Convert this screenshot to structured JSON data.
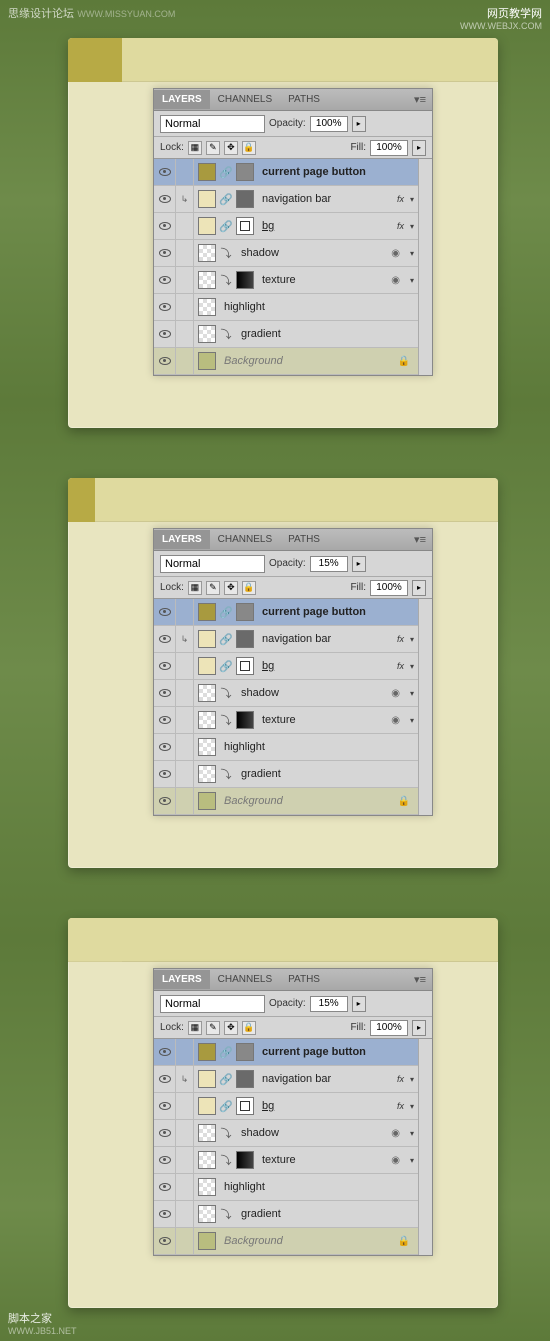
{
  "watermarks": {
    "top_left": "思缘设计论坛",
    "top_left_sub": "WWW.MISSYUAN.COM",
    "top_right": "网页教学网",
    "top_right_sub": "WWW.WEBJX.COM",
    "bottom_left": "脚本之家",
    "bottom_left_sub": "WWW.JB51.NET"
  },
  "panel": {
    "tabs": {
      "layers": "LAYERS",
      "channels": "CHANNELS",
      "paths": "PATHS"
    },
    "blend_mode": "Normal",
    "opacity_label": "Opacity:",
    "fill_label": "Fill:",
    "lock_label": "Lock:",
    "fill_value": "100%",
    "layers": [
      {
        "name": "current page button",
        "bold": true
      },
      {
        "name": "navigation bar"
      },
      {
        "name": "bg",
        "ul": true
      },
      {
        "name": "shadow"
      },
      {
        "name": "texture"
      },
      {
        "name": "highlight"
      },
      {
        "name": "gradient"
      },
      {
        "name": "Background",
        "italic": true
      }
    ]
  },
  "steps": [
    {
      "opacity": "100%",
      "tab_style": "solid"
    },
    {
      "opacity": "15%",
      "tab_style": "half"
    },
    {
      "opacity": "15%",
      "tab_style": "full"
    }
  ]
}
